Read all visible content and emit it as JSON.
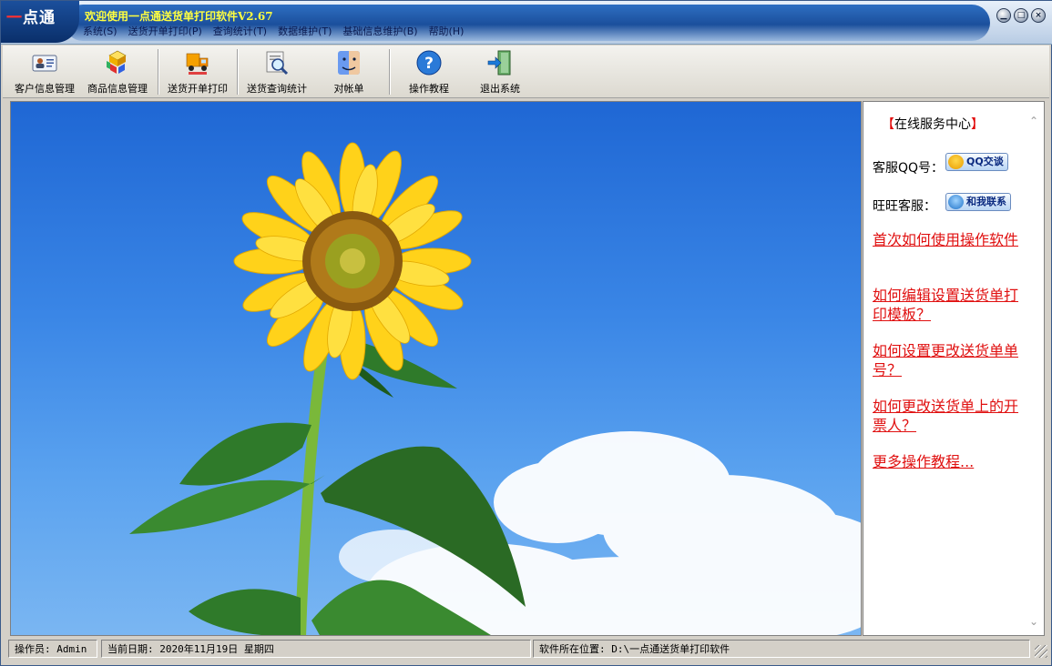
{
  "app": {
    "logo_text": "点通",
    "logo_dash": "一",
    "title": "欢迎使用一点通送货单打印软件V2.67"
  },
  "menu": [
    {
      "label": "系统(S)"
    },
    {
      "label": "送货开单打印(P)"
    },
    {
      "label": "查询统计(T)"
    },
    {
      "label": "数据维护(T)"
    },
    {
      "label": "基础信息维护(B)"
    },
    {
      "label": "帮助(H)"
    }
  ],
  "window_controls": {
    "minimize": "▁",
    "maximize": "□",
    "close": "×"
  },
  "toolbar": [
    {
      "label": "客户信息管理",
      "icon": "customer-card-icon"
    },
    {
      "label": "商品信息管理",
      "icon": "product-boxes-icon"
    },
    {
      "label": "送货开单打印",
      "icon": "delivery-truck-icon"
    },
    {
      "label": "送货查询统计",
      "icon": "search-report-icon"
    },
    {
      "label": "对帐单",
      "icon": "finder-face-icon"
    },
    {
      "label": "操作教程",
      "icon": "help-icon"
    },
    {
      "label": "退出系统",
      "icon": "exit-door-icon"
    }
  ],
  "service_panel": {
    "title_open": "【",
    "title": "在线服务中心",
    "title_close": "】",
    "qq_label": "客服QQ号：",
    "qq_button": "QQ交谈",
    "wangwang_label": "旺旺客服：",
    "wangwang_button": "和我联系",
    "links": [
      "首次如何使用操作软件",
      "如何编辑设置送货单打印模板？",
      "如何设置更改送货单单号？",
      "如何更改送货单上的开票人？",
      "更多操作教程..."
    ]
  },
  "status": {
    "operator": "操作员: Admin",
    "date": "当前日期: 2020年11月19日 星期四",
    "location": "软件所在位置: D:\\一点通送货单打印软件"
  },
  "colors": {
    "title_text": "#ffff40",
    "link_red": "#e01010",
    "sky_blue": "#3a86e6",
    "title_band": "#1b4f9c"
  }
}
